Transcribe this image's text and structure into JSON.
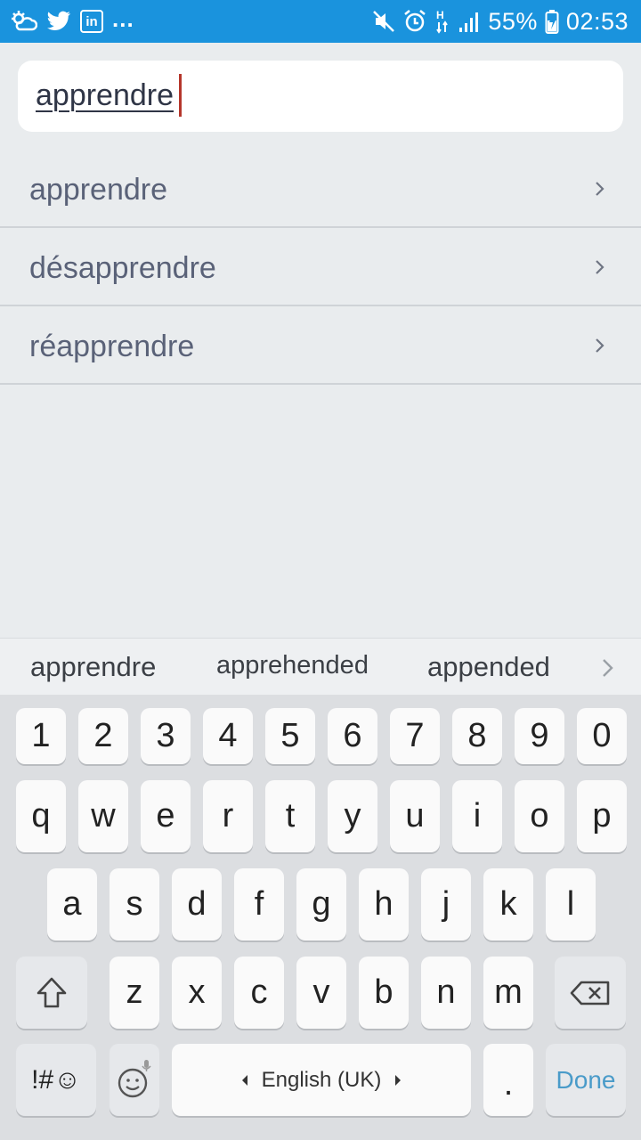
{
  "status_bar": {
    "overflow": "...",
    "battery": "55%",
    "time": "02:53",
    "icons": [
      "weather-icon",
      "twitter-icon",
      "linkedin-icon",
      "mute-icon",
      "alarm-icon",
      "h-network-icon",
      "signal-icon",
      "battery-icon"
    ],
    "linkedin_label": "in"
  },
  "search": {
    "value": "apprendre"
  },
  "results": [
    {
      "label": "apprendre"
    },
    {
      "label": "désapprendre"
    },
    {
      "label": "réapprendre"
    }
  ],
  "suggestions": {
    "items": [
      "apprendre",
      "apprehended",
      "appended"
    ]
  },
  "keyboard": {
    "numbers": [
      "1",
      "2",
      "3",
      "4",
      "5",
      "6",
      "7",
      "8",
      "9",
      "0"
    ],
    "row1": [
      "q",
      "w",
      "e",
      "r",
      "t",
      "y",
      "u",
      "i",
      "o",
      "p"
    ],
    "row2": [
      "a",
      "s",
      "d",
      "f",
      "g",
      "h",
      "j",
      "k",
      "l"
    ],
    "row3": [
      "z",
      "x",
      "c",
      "v",
      "b",
      "n",
      "m"
    ],
    "symbols_label": "!#☺",
    "space_label": "English (UK)",
    "period_label": ".",
    "done_label": "Done"
  },
  "colors": {
    "status_bar": "#1a93dd",
    "caret": "#b5362b",
    "done": "#4a9bc9"
  }
}
